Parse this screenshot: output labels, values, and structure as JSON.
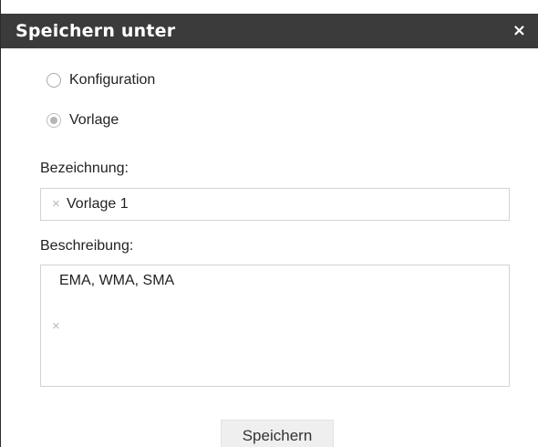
{
  "dialog": {
    "title": "Speichern unter",
    "close_icon": "×"
  },
  "save_type": {
    "options": [
      {
        "label": "Konfiguration",
        "selected": false
      },
      {
        "label": "Vorlage",
        "selected": true
      }
    ]
  },
  "name_field": {
    "label": "Bezeichnung:",
    "value": "Vorlage 1",
    "clear_icon": "×"
  },
  "description_field": {
    "label": "Beschreibung:",
    "value": "EMA, WMA, SMA",
    "clear_icon": "×"
  },
  "actions": {
    "save_label": "Speichern"
  }
}
